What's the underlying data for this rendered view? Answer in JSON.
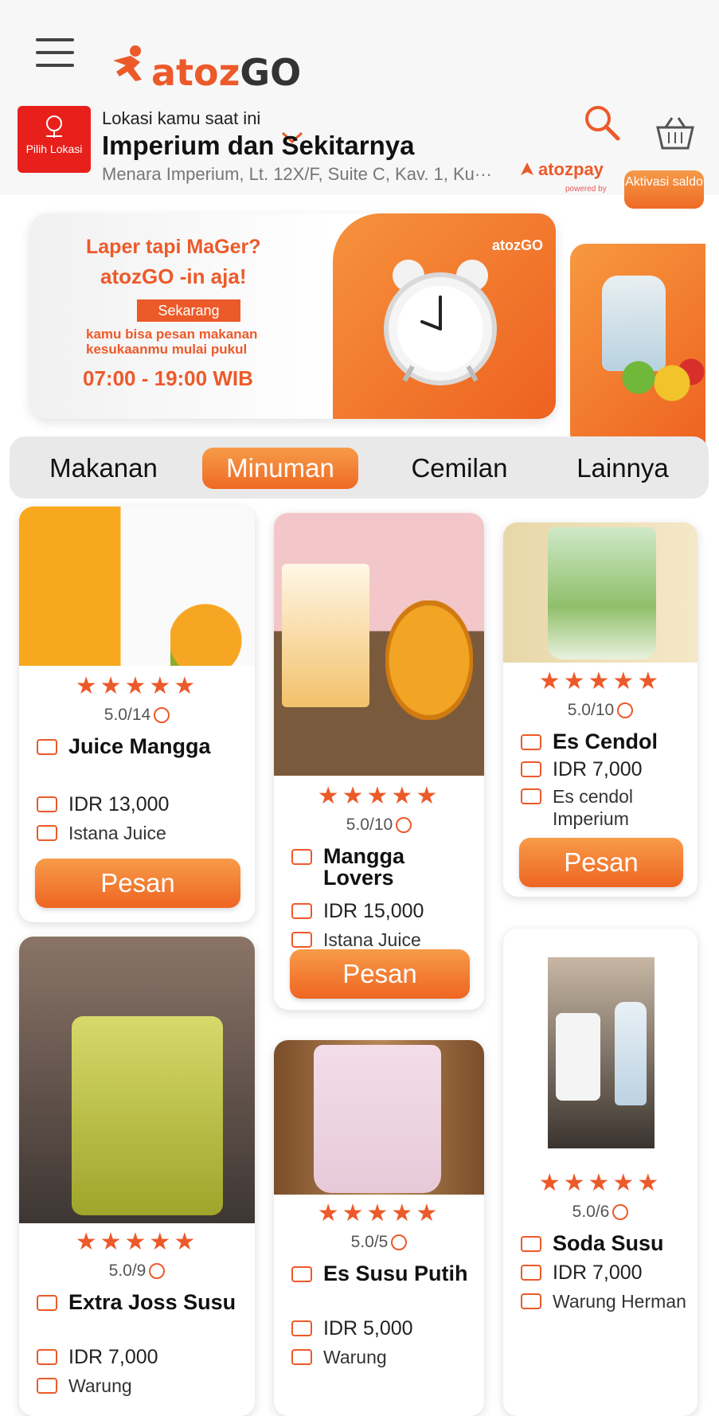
{
  "header": {
    "logo_word_orange": "atoz",
    "logo_word_dark": "GO",
    "pin_label": "Pilih Lokasi",
    "location_caption": "Lokasi kamu saat ini",
    "location_title": "Imperium dan Sekitarnya",
    "location_address": "Menara Imperium, Lt. 12X/F, Suite C, Kav. 1, Ku···",
    "pay_name": "atozpay",
    "pay_sub": "powered by",
    "activate_label": "Aktivasi saldo"
  },
  "banner": {
    "line1": "Laper tapi MaGer?",
    "line2_logo": "atozGO",
    "line2_suffix": "-in aja!",
    "badge": "Sekarang",
    "description": "kamu bisa pesan makanan kesukaanmu mulai pukul",
    "hours": "07:00 - 19:00 WIB",
    "small_logo": "atozGO"
  },
  "tabs": [
    "Makanan",
    "Minuman",
    "Cemilan",
    "Lainnya"
  ],
  "active_tab": "Minuman",
  "products": [
    {
      "stars": "★★★★★",
      "rating": "5.0/14",
      "name": "Juice Mangga",
      "price": "IDR 13,000",
      "store": "Istana Juice",
      "button": "Pesan"
    },
    {
      "stars": "★★★★★",
      "rating": "5.0/10",
      "name": "Mangga Lovers",
      "price": "IDR 15,000",
      "store": "Istana Juice",
      "button": "Pesan"
    },
    {
      "stars": "★★★★★",
      "rating": "5.0/10",
      "name": "Es Cendol",
      "price": "IDR 7,000",
      "store": "Es cendol Imperium",
      "button": "Pesan"
    },
    {
      "stars": "★★★★★",
      "rating": "5.0/9",
      "name": "Extra Joss Susu",
      "price": "IDR 7,000",
      "store": "Warung"
    },
    {
      "stars": "★★★★★",
      "rating": "5.0/5",
      "name": "Es Susu Putih",
      "price": "IDR 5,000",
      "store": "Warung"
    },
    {
      "stars": "★★★★★",
      "rating": "5.0/6",
      "name": "Soda Susu",
      "price": "IDR 7,000",
      "store": "Warung Herman"
    }
  ]
}
